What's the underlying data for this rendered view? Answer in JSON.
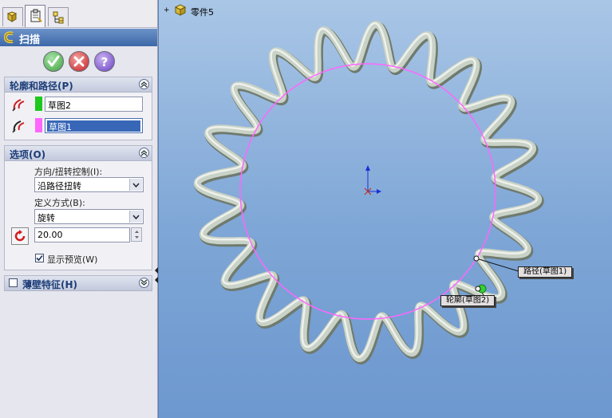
{
  "feature_title": "扫描",
  "tabs": [
    "feature-manager",
    "property-manager",
    "configuration-manager"
  ],
  "actions": {
    "ok": "ok-icon",
    "cancel": "cancel-icon",
    "help": "help-icon"
  },
  "groups": {
    "profile_path": {
      "title": "轮廓和路径(P)",
      "profile_value": "草图2",
      "path_value": "草图1",
      "profile_color": "#1ec81e",
      "path_color": "#ff66ff"
    },
    "options": {
      "title": "选项(O)",
      "orientation_label": "方向/扭转控制(I):",
      "orientation_value": "沿路径扭转",
      "define_label": "定义方式(B):",
      "define_value": "旋转",
      "turns_value": "20.00",
      "preview_label": "显示预览(W)",
      "preview_checked": true
    },
    "thin_feature": {
      "title": "薄壁特征(H)",
      "checked": false
    }
  },
  "viewport": {
    "part_name": "零件5",
    "path_callout": "路径(草图1)",
    "profile_callout": "轮廓(草图2)",
    "path_circle_color": "#ff66ff",
    "sweep_color": "#c9d2c6"
  }
}
